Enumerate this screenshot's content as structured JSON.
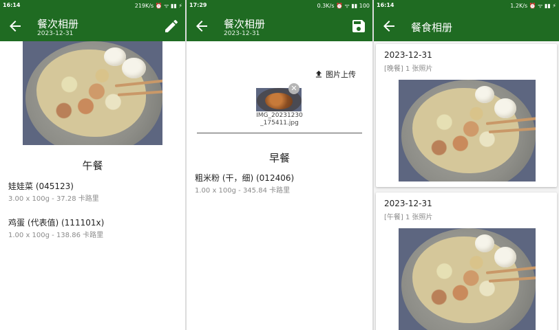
{
  "left": {
    "status_time": "16:14",
    "status_right": "219K/s ⏰ ᯤ ▮▮ ⚡",
    "title": "餐次相册",
    "subtitle": "2023-12-31",
    "meal": "午餐",
    "foods": [
      {
        "name": "娃娃菜 (045123)",
        "detail": "3.00 x 100g  - 37.28 卡路里"
      },
      {
        "name": "鸡蛋 (代表值) (111101x)",
        "detail": "1.00 x 100g  - 138.86 卡路里"
      }
    ]
  },
  "middle": {
    "status_time": "17:29",
    "status_right": "0.3K/s ⏰ ᯤ ▮▮ 100",
    "title": "餐次相册",
    "subtitle": "2023-12-31",
    "upload_label": "图片上传",
    "file_name": "IMG_20231230_175411.jpg",
    "meal": "早餐",
    "foods": [
      {
        "name": "粗米粉 (干，细) (012406)",
        "detail": "1.00 x 100g  - 345.84 卡路里"
      }
    ]
  },
  "right": {
    "status_time": "16:14",
    "status_right": "1.2K/s ⏰ ᯤ ▮▮ ⚡",
    "title": "餐食相册",
    "cards": [
      {
        "date": "2023-12-31",
        "info": "[晚餐] 1 张照片"
      },
      {
        "date": "2023-12-31",
        "info": "[午餐] 1 张照片"
      }
    ]
  },
  "icons": {
    "back": "arrow-back-icon",
    "edit": "pencil-icon",
    "save": "floppy-disk-icon",
    "upload": "upload-icon",
    "close": "close-icon"
  },
  "colors": {
    "appbar": "#1f6b22",
    "text": "#222222",
    "muted": "#8a8a8a"
  }
}
